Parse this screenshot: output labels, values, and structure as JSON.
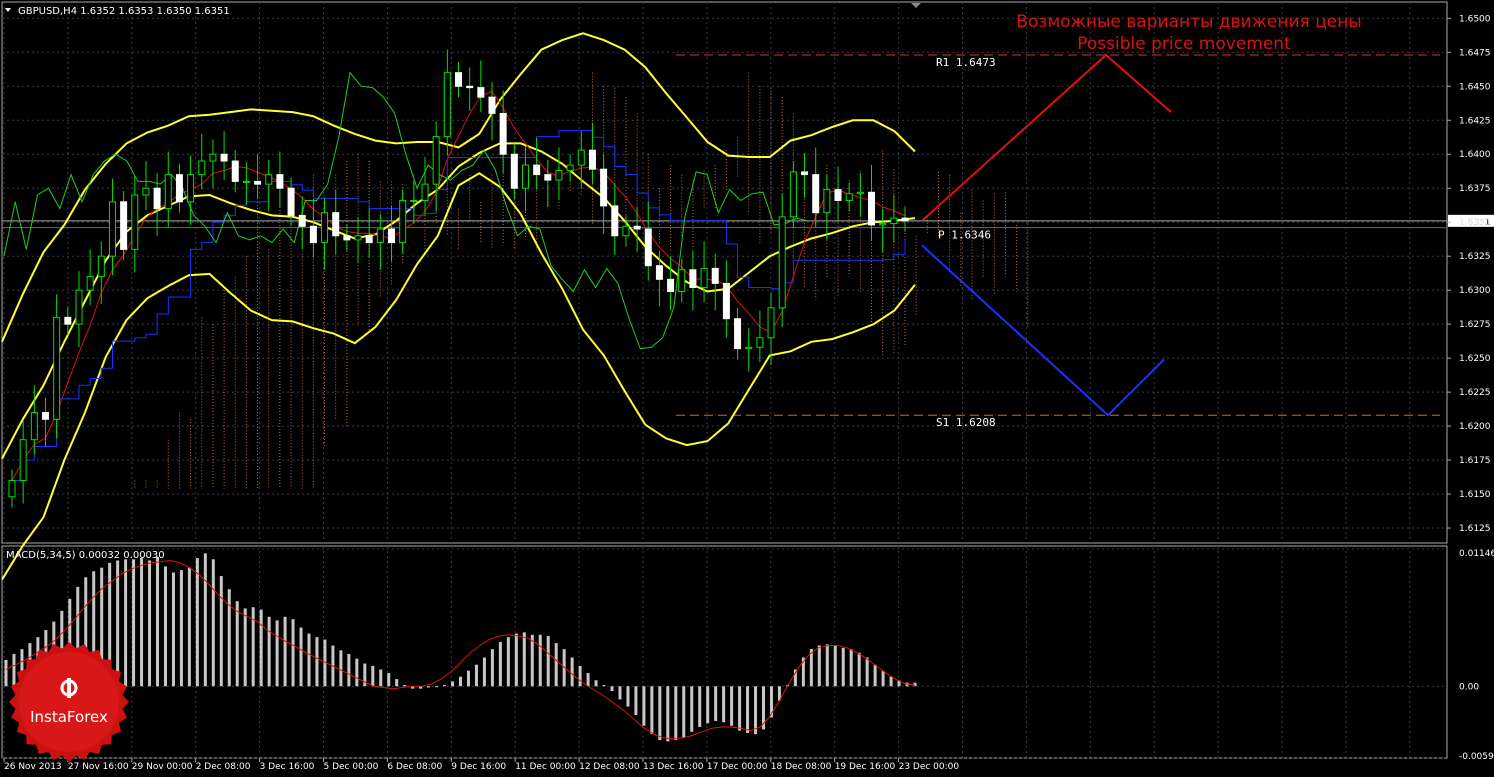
{
  "chart_data": [
    {
      "type": "candlestick",
      "symbol_header": "GBPUSD,H4  1.6352 1.6353 1.6350 1.6351",
      "annotation_ru": "Возможные варианты движения цены",
      "annotation_en": "Possible price movement",
      "current_price": 1.6351,
      "current_price_label": "1.6351",
      "ylim": [
        1.6114,
        1.6512
      ],
      "y_ticks": [
        "1.6500",
        "1.6475",
        "1.6450",
        "1.6425",
        "1.6400",
        "1.6375",
        "1.6350",
        "1.6325",
        "1.6300",
        "1.6275",
        "1.6250",
        "1.6225",
        "1.6200",
        "1.6175",
        "1.6150",
        "1.6125"
      ],
      "levels": [
        {
          "name": "R1",
          "label": "R1  1.6473",
          "value": 1.6473,
          "color": "#cc3333"
        },
        {
          "name": "P",
          "label": "P  1.6346",
          "value": 1.6346,
          "color": "#ffffff"
        },
        {
          "name": "S1",
          "label": "S1  1.6208",
          "value": 1.6208,
          "color": "#cc6633"
        }
      ],
      "x_labels": [
        "26 Nov 2013",
        "27 Nov 16:00",
        "29 Nov 00:00",
        "2 Dec 08:00",
        "3 Dec 16:00",
        "5 Dec 00:00",
        "6 Dec 08:00",
        "9 Dec 16:00",
        "11 Dec 00:00",
        "12 Dec 08:00",
        "13 Dec 16:00",
        "17 Dec 00:00",
        "18 Dec 08:00",
        "19 Dec 16:00",
        "23 Dec 00:00"
      ],
      "close": [
        1.616,
        1.619,
        1.621,
        1.6205,
        1.628,
        1.6275,
        1.63,
        1.631,
        1.6325,
        1.6365,
        1.633,
        1.637,
        1.6375,
        1.636,
        1.6385,
        1.6365,
        1.6385,
        1.6395,
        1.64,
        1.6395,
        1.638,
        1.638,
        1.6378,
        1.6385,
        1.6375,
        1.6355,
        1.6347,
        1.6335,
        1.6357,
        1.634,
        1.6337,
        1.634,
        1.6335,
        1.6345,
        1.6335,
        1.6366,
        1.6366,
        1.6378,
        1.6413,
        1.646,
        1.645,
        1.6449,
        1.6442,
        1.643,
        1.64,
        1.6375,
        1.6392,
        1.6385,
        1.6381,
        1.6388,
        1.6392,
        1.6403,
        1.6389,
        1.6362,
        1.634,
        1.6347,
        1.6345,
        1.6318,
        1.6308,
        1.6299,
        1.6315,
        1.6302,
        1.6316,
        1.6305,
        1.6279,
        1.6257,
        1.6258,
        1.6265,
        1.6287,
        1.6354,
        1.6387,
        1.6385,
        1.6357,
        1.6374,
        1.6366,
        1.6371,
        1.6372,
        1.6348,
        1.6349,
        1.6353,
        1.6351
      ],
      "upper_band": [
        1.6262,
        1.6297,
        1.6328,
        1.6348,
        1.6374,
        1.6393,
        1.6408,
        1.6416,
        1.6421,
        1.6428,
        1.6429,
        1.6431,
        1.6433,
        1.6432,
        1.6431,
        1.6428,
        1.6421,
        1.6415,
        1.641,
        1.6408,
        1.6409,
        1.6409,
        1.6405,
        1.6415,
        1.644,
        1.6459,
        1.6477,
        1.6484,
        1.6489,
        1.6484,
        1.6477,
        1.6464,
        1.6445,
        1.6427,
        1.6409,
        1.6399,
        1.6398,
        1.6398,
        1.641,
        1.6414,
        1.642,
        1.6425,
        1.6425,
        1.6417,
        1.6402
      ],
      "middle_band": [
        1.6176,
        1.6205,
        1.623,
        1.6262,
        1.6292,
        1.6322,
        1.6343,
        1.6355,
        1.6362,
        1.6369,
        1.637,
        1.6364,
        1.6359,
        1.6355,
        1.6354,
        1.635,
        1.6344,
        1.6338,
        1.6341,
        1.6351,
        1.6364,
        1.6374,
        1.6391,
        1.6401,
        1.6408,
        1.6408,
        1.6402,
        1.6393,
        1.638,
        1.6368,
        1.6351,
        1.6332,
        1.6318,
        1.6306,
        1.6299,
        1.6301,
        1.6313,
        1.6325,
        1.6332,
        1.6338,
        1.6342,
        1.6347,
        1.635,
        1.6351,
        1.6353
      ],
      "lower_band": [
        1.6087,
        1.6112,
        1.6133,
        1.6175,
        1.621,
        1.6251,
        1.6278,
        1.6294,
        1.6303,
        1.6311,
        1.6312,
        1.6298,
        1.6285,
        1.6278,
        1.6277,
        1.6272,
        1.6268,
        1.6261,
        1.6273,
        1.6293,
        1.6319,
        1.634,
        1.6377,
        1.6386,
        1.6376,
        1.6356,
        1.6327,
        1.6301,
        1.6271,
        1.6252,
        1.6226,
        1.6201,
        1.6191,
        1.6186,
        1.6189,
        1.6202,
        1.6227,
        1.6252,
        1.6255,
        1.6262,
        1.6264,
        1.6269,
        1.6275,
        1.6285,
        1.6304
      ],
      "macd_header": "MACD(5,34,5) 0.00032 0.00030",
      "macd_ylim": [
        -0.00599,
        0.01146
      ],
      "macd_ticks": [
        "0.01146",
        "0.00",
        "-0.00599"
      ],
      "macd_hist": [
        0.0022,
        0.0027,
        0.0031,
        0.0036,
        0.0041,
        0.0047,
        0.0054,
        0.0063,
        0.0073,
        0.0083,
        0.0091,
        0.0096,
        0.0099,
        0.0103,
        0.0105,
        0.0106,
        0.0106,
        0.0107,
        0.0105,
        0.0108,
        0.01,
        0.0095,
        0.0097,
        0.0099,
        0.0107,
        0.0111,
        0.0106,
        0.0092,
        0.0081,
        0.0071,
        0.0065,
        0.0066,
        0.0064,
        0.0058,
        0.0055,
        0.0058,
        0.0056,
        0.0049,
        0.0044,
        0.0041,
        0.0039,
        0.0034,
        0.003,
        0.0027,
        0.0023,
        0.0019,
        0.0017,
        0.0014,
        0.0011,
        0.0006,
        0.0001,
        -0.0002,
        -0.0002,
        -0.0001,
        0,
        0.0001,
        0.0004,
        0.0008,
        0.0013,
        0.0018,
        0.0024,
        0.0031,
        0.0037,
        0.0041,
        0.0044,
        0.0045,
        0.0043,
        0.0043,
        0.0042,
        0.0036,
        0.0031,
        0.0024,
        0.0017,
        0.0011,
        0.0005,
        0.0001,
        -0.0004,
        -0.0011,
        -0.0017,
        -0.0024,
        -0.0033,
        -0.004,
        -0.0045,
        -0.0046,
        -0.0045,
        -0.0043,
        -0.0038,
        -0.0034,
        -0.0031,
        -0.0029,
        -0.003,
        -0.0033,
        -0.0037,
        -0.0039,
        -0.004,
        -0.0036,
        -0.0026,
        -0.0012,
        0.0001,
        0.0014,
        0.0024,
        0.0031,
        0.0034,
        0.0035,
        0.0034,
        0.0032,
        0.0031,
        0.0028,
        0.0024,
        0.0018,
        0.0013,
        0.0008,
        0.0005,
        0.0003,
        0.0003
      ],
      "macd_signal": [
        0.0014,
        0.0018,
        0.0022,
        0.0027,
        0.0032,
        0.0038,
        0.0046,
        0.0055,
        0.0065,
        0.0074,
        0.0082,
        0.0088,
        0.0094,
        0.0098,
        0.0101,
        0.0103,
        0.0104,
        0.0105,
        0.0103,
        0.0099,
        0.0093,
        0.0085,
        0.0076,
        0.0068,
        0.0062,
        0.0058,
        0.0054,
        0.0047,
        0.0042,
        0.0037,
        0.0033,
        0.0028,
        0.0024,
        0.002,
        0.0016,
        0.0012,
        0.0008,
        0.0004,
        0,
        -0.0001,
        -0.0002,
        -0.0001,
        0,
        0,
        0.0002,
        0.0006,
        0.0012,
        0.002,
        0.0028,
        0.0034,
        0.0039,
        0.0042,
        0.0043,
        0.0042,
        0.004,
        0.0035,
        0.0028,
        0.0021,
        0.0014,
        0.0007,
        0.0001,
        -0.0004,
        -0.0009,
        -0.0015,
        -0.0021,
        -0.0028,
        -0.0035,
        -0.004,
        -0.0043,
        -0.0044,
        -0.0043,
        -0.0041,
        -0.0038,
        -0.0035,
        -0.0034,
        -0.0034,
        -0.0035,
        -0.0037,
        -0.0034,
        -0.0025,
        -0.0012,
        0.0003,
        0.0016,
        0.0026,
        0.0032,
        0.0034,
        0.0034,
        0.0032,
        0.0028,
        0.0023,
        0.0017,
        0.0011,
        0.0006,
        0.0002,
        0.0001
      ],
      "scenario_up": [
        1.6351,
        1.6473,
        1.6431
      ],
      "scenario_down": [
        1.6333,
        1.6208,
        1.6249
      ],
      "colors": {
        "background": "#000000",
        "grid": "#3a3a4a",
        "candle_up": "#00e000",
        "candle_down": "#ffffff",
        "bollinger": "#ffff33",
        "tenkan": "#dd1111",
        "kijun": "#1f2fff",
        "chikou": "#22cc22",
        "cloud": "#c4713a",
        "up_scenario": "#dd1111",
        "down_scenario": "#1f2fff",
        "macd_hist": "#c8c8c8",
        "macd_signal": "#dd1111"
      }
    }
  ],
  "logo": {
    "brand_text": "InstaForex"
  }
}
